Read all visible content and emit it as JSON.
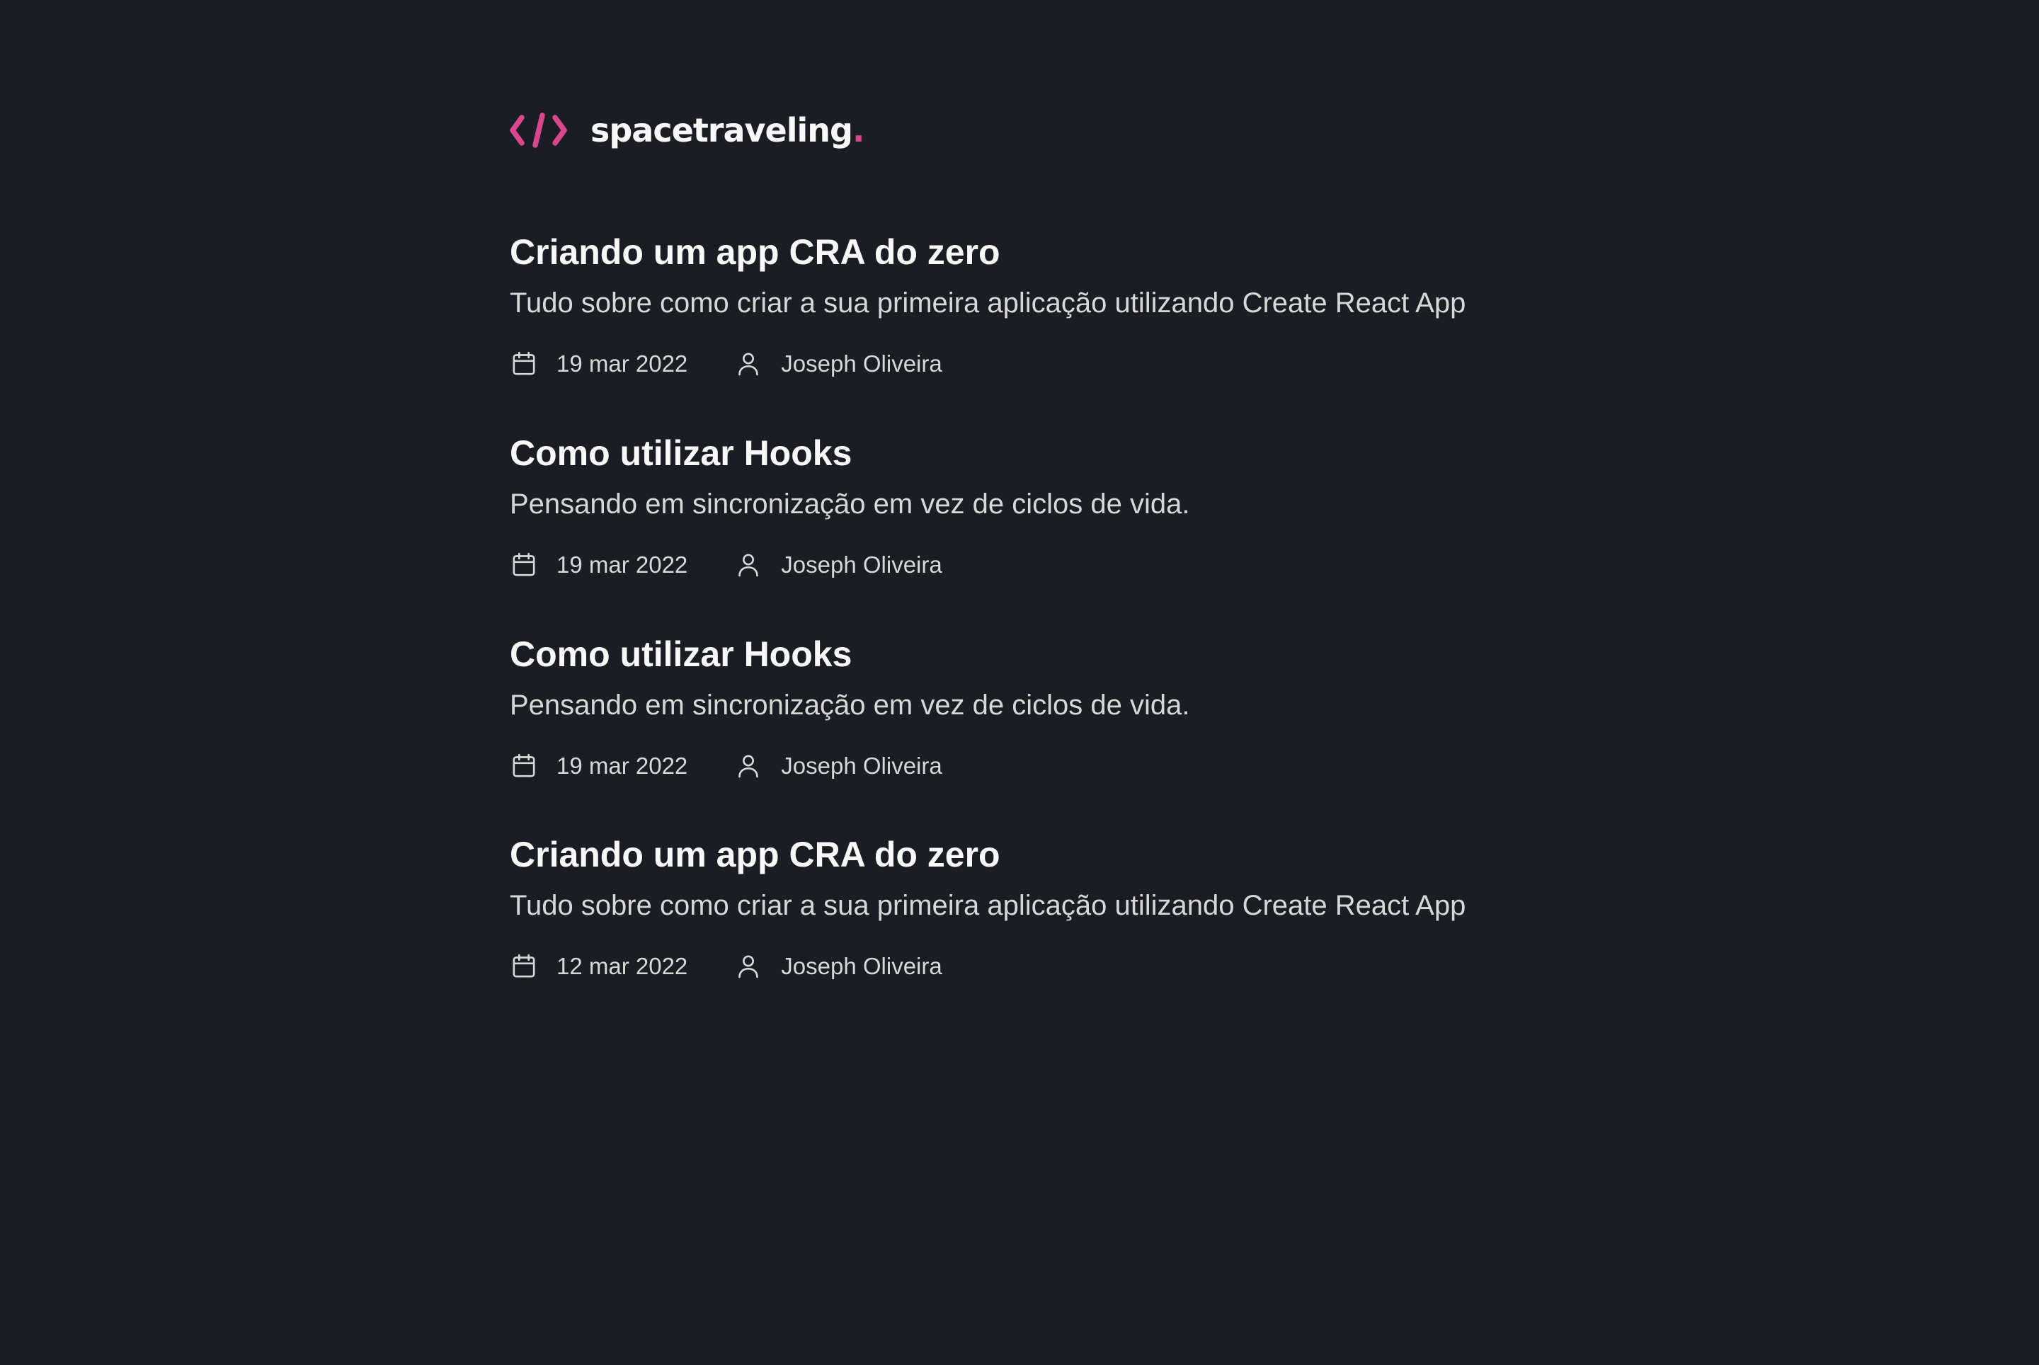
{
  "header": {
    "logo_text": "spacetraveling",
    "logo_dot": ".",
    "logo_icon": "code-brackets-icon",
    "accent_color": "#D9468C"
  },
  "posts": [
    {
      "title": "Criando um app CRA do zero",
      "subtitle": "Tudo sobre como criar a sua primeira aplicação utilizando Create React App",
      "date": "19 mar 2022",
      "author": "Joseph Oliveira"
    },
    {
      "title": "Como utilizar Hooks",
      "subtitle": "Pensando em sincronização em vez de ciclos de vida.",
      "date": "19 mar 2022",
      "author": "Joseph Oliveira"
    },
    {
      "title": "Como utilizar Hooks",
      "subtitle": "Pensando em sincronização em vez de ciclos de vida.",
      "date": "19 mar 2022",
      "author": "Joseph Oliveira"
    },
    {
      "title": "Criando um app CRA do zero",
      "subtitle": "Tudo sobre como criar a sua primeira aplicação utilizando Create React App",
      "date": "12 mar 2022",
      "author": "Joseph Oliveira"
    }
  ],
  "icons": {
    "date": "calendar-icon",
    "author": "user-icon"
  },
  "colors": {
    "background": "#1A1D23",
    "heading": "#F8F8F8",
    "body_text": "#D7D7D7"
  }
}
